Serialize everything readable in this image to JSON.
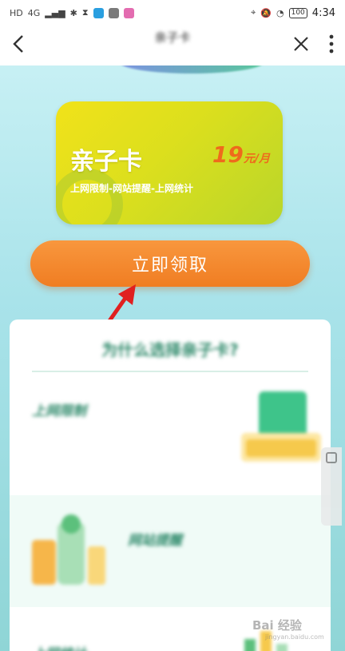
{
  "status_bar": {
    "left_label": "HD",
    "network": "4G",
    "battery": "100",
    "time": "4:34"
  },
  "nav": {
    "back_icon": "back-arrow-icon",
    "title": "亲子卡",
    "subtitle": "",
    "close_icon": "close-icon",
    "more_icon": "more-vertical-icon"
  },
  "card": {
    "title": "亲子卡",
    "price_number": "19",
    "price_unit": "元/月",
    "features": "上网限制-网站提醒-上网统计",
    "gradient_start": "#f1e21a",
    "gradient_end": "#b9d62a"
  },
  "claim_button": {
    "label": "立即领取",
    "color": "#f07d22"
  },
  "panel": {
    "title": "为什么选择亲子卡?",
    "features": [
      {
        "title": "上网限制",
        "description": "",
        "illustration": "card-tray-illustration"
      },
      {
        "title": "网站提醒",
        "description": "",
        "illustration": "phone-bottle-illustration"
      },
      {
        "title": "上网统计",
        "description": "",
        "illustration": "chart-illustration"
      }
    ]
  },
  "watermark": {
    "text": "Bai 经验",
    "sub": "jingyan.baidu.com"
  },
  "accent_color": "#2f8a6b"
}
